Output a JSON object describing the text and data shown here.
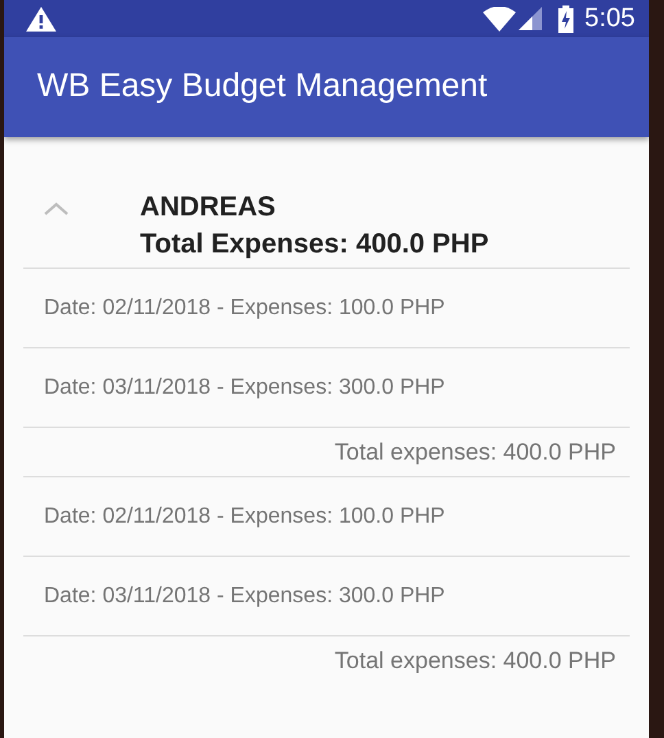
{
  "status_bar": {
    "time": "5:05"
  },
  "app_bar": {
    "title": "WB Easy Budget Management"
  },
  "group": {
    "name": "ANDREAS",
    "total": "Total Expenses: 400.0 PHP",
    "expanded": true,
    "sections": [
      {
        "entries": [
          "Date: 02/11/2018 - Expenses: 100.0 PHP",
          "Date: 03/11/2018 - Expenses: 300.0 PHP"
        ],
        "total": "Total expenses: 400.0 PHP"
      },
      {
        "entries": [
          "Date: 02/11/2018 - Expenses: 100.0 PHP",
          "Date: 03/11/2018 - Expenses: 300.0 PHP"
        ],
        "total": "Total expenses: 400.0 PHP"
      }
    ]
  }
}
